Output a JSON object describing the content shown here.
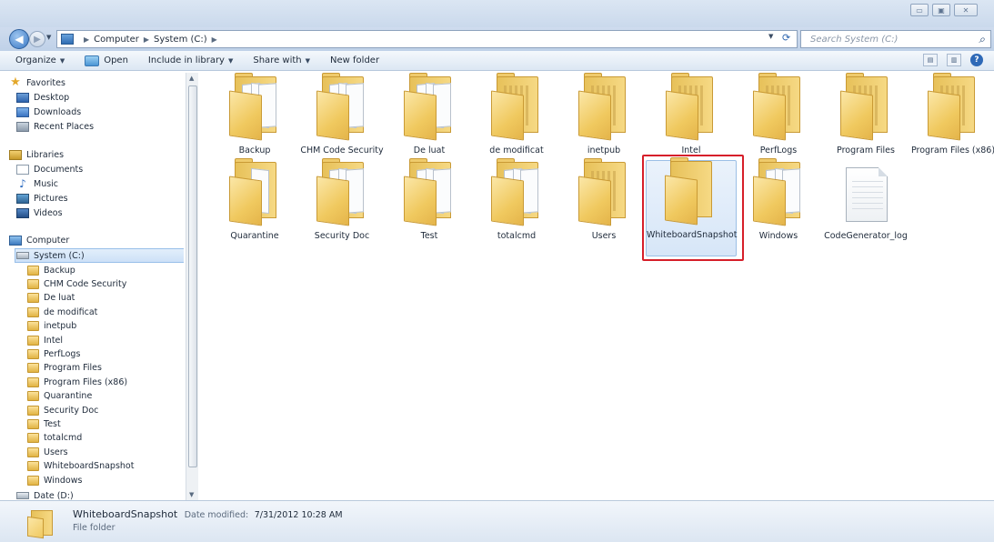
{
  "window": {
    "minimize": "▭",
    "maximize": "▣",
    "close": "✕"
  },
  "nav": {
    "back": "◀",
    "forward": "▶",
    "refresh": "⟳",
    "breadcrumb": [
      "Computer",
      "System (C:)"
    ],
    "search_placeholder": "Search System (C:)"
  },
  "toolbar": {
    "organize": "Organize",
    "open": "Open",
    "include_in_library": "Include in library",
    "share_with": "Share with",
    "new_folder": "New folder"
  },
  "sidebar": {
    "favorites_header": "Favorites",
    "favorites": [
      "Desktop",
      "Downloads",
      "Recent Places"
    ],
    "libraries_header": "Libraries",
    "libraries": [
      "Documents",
      "Music",
      "Pictures",
      "Videos"
    ],
    "computer_header": "Computer",
    "system_drive": "System (C:)",
    "drive_folders": [
      "Backup",
      "CHM Code Security",
      "De luat",
      "de modificat",
      "inetpub",
      "Intel",
      "PerfLogs",
      "Program Files",
      "Program Files (x86)",
      "Quarantine",
      "Security Doc",
      "Test",
      "totalcmd",
      "Users",
      "WhiteboardSnapshot",
      "Windows"
    ],
    "data_drive": "Date (D:)"
  },
  "items": [
    {
      "label": "Backup",
      "kind": "folder-docs"
    },
    {
      "label": "CHM Code Security",
      "kind": "folder-docs"
    },
    {
      "label": "De luat",
      "kind": "folder-docs"
    },
    {
      "label": "de modificat",
      "kind": "folder-strips"
    },
    {
      "label": "inetpub",
      "kind": "folder-strips"
    },
    {
      "label": "Intel",
      "kind": "folder-strips"
    },
    {
      "label": "PerfLogs",
      "kind": "folder-strips"
    },
    {
      "label": "Program Files",
      "kind": "folder-strips"
    },
    {
      "label": "Program Files (x86)",
      "kind": "folder-strips"
    },
    {
      "label": "Quarantine",
      "kind": "folder-blank"
    },
    {
      "label": "Security Doc",
      "kind": "folder-docs"
    },
    {
      "label": "Test",
      "kind": "folder-docs"
    },
    {
      "label": "totalcmd",
      "kind": "folder-docs"
    },
    {
      "label": "Users",
      "kind": "folder-strips"
    },
    {
      "label": "WhiteboardSnapshot",
      "kind": "folder-empty",
      "selected": true
    },
    {
      "label": "Windows",
      "kind": "folder-docs"
    },
    {
      "label": "CodeGenerator_log",
      "kind": "file"
    }
  ],
  "details": {
    "name": "WhiteboardSnapshot",
    "modified_label": "Date modified:",
    "modified": "7/31/2012 10:28 AM",
    "type": "File folder"
  },
  "colors": {
    "highlight": "#d61f2a",
    "selection": "#cde1f7"
  }
}
